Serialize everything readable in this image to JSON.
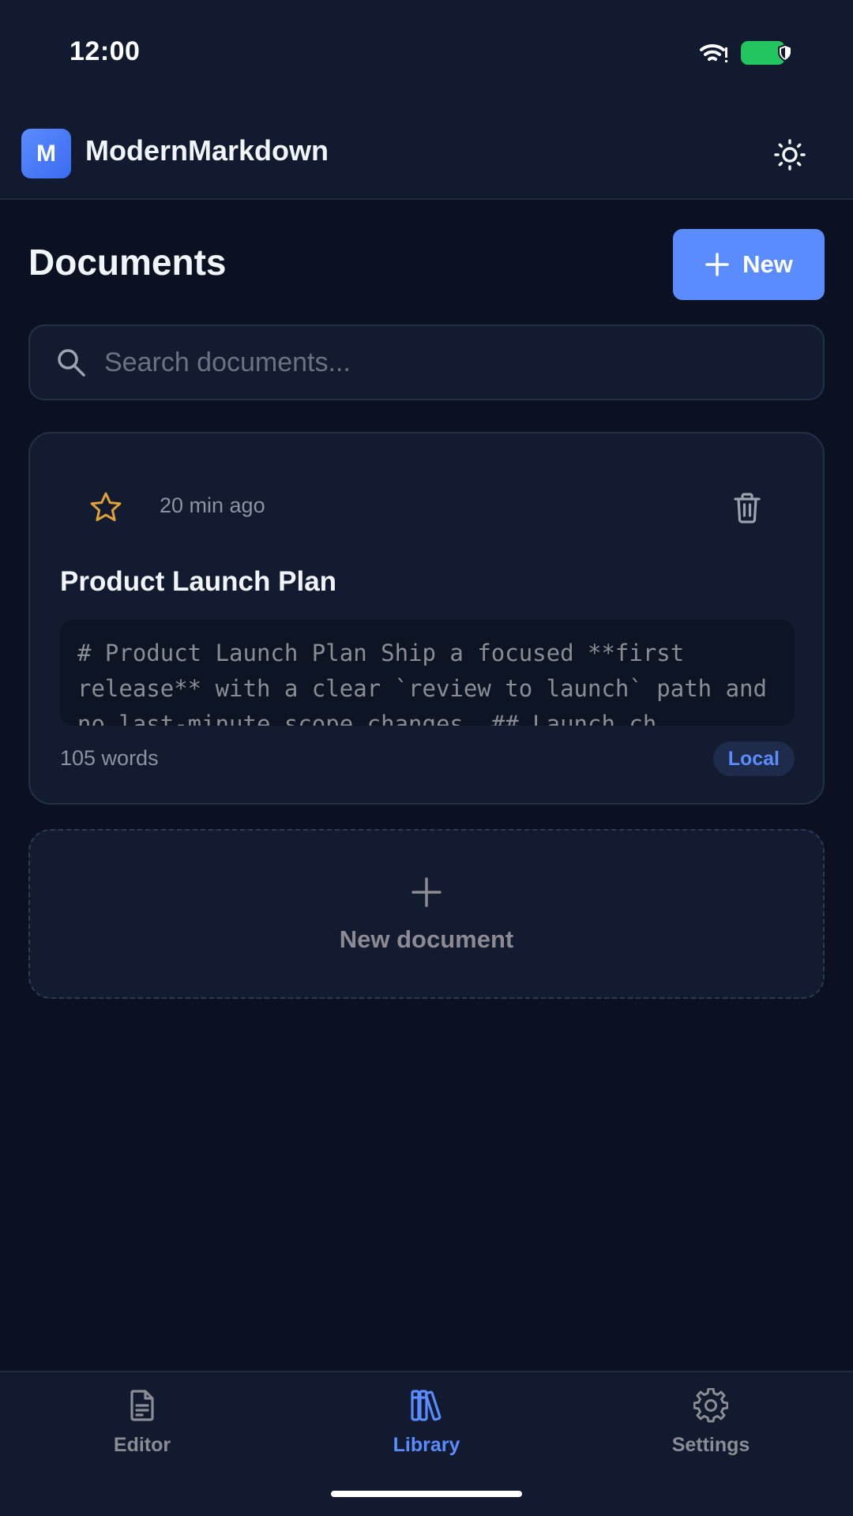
{
  "status_bar": {
    "time": "12:00",
    "battery_color": "#22c55e"
  },
  "app": {
    "logo_letter": "M",
    "title": "ModernMarkdown",
    "theme_icon": "sun-icon"
  },
  "documents": {
    "heading": "Documents",
    "new_button_label": "New",
    "search_placeholder": "Search documents...",
    "items": [
      {
        "starred": false,
        "time": "20 min ago",
        "title": "Product Launch Plan",
        "preview": "# Product Launch Plan Ship a focused **first release** with a clear `review to launch` path and no last-minute scope changes. ## Launch ch",
        "words": "105 words",
        "badge": "Local"
      }
    ],
    "new_document_label": "New document"
  },
  "nav": {
    "items": [
      {
        "label": "Editor",
        "icon": "file-text-icon",
        "active": false
      },
      {
        "label": "Library",
        "icon": "library-icon",
        "active": true
      },
      {
        "label": "Settings",
        "icon": "gear-icon",
        "active": false
      }
    ]
  },
  "colors": {
    "accent": "#5b8cff",
    "star": "#e0a03a",
    "background": "#0b1120",
    "surface": "#121b2f"
  }
}
